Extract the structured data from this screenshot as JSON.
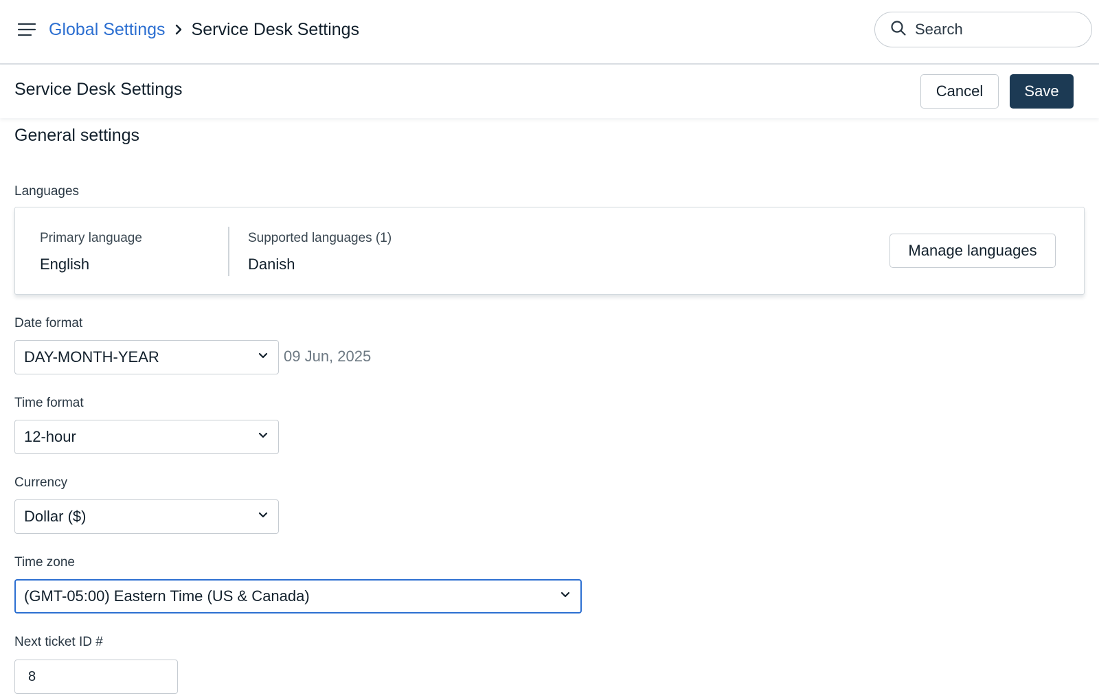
{
  "breadcrumb": {
    "parent": "Global Settings",
    "current": "Service Desk Settings"
  },
  "search": {
    "placeholder": "Search"
  },
  "header": {
    "title": "Service Desk Settings",
    "cancel_label": "Cancel",
    "save_label": "Save"
  },
  "general": {
    "title": "General settings",
    "languages": {
      "label": "Languages",
      "primary_label": "Primary language",
      "primary_value": "English",
      "supported_label": "Supported languages (1)",
      "supported_value": "Danish",
      "manage_label": "Manage languages"
    },
    "date_format": {
      "label": "Date format",
      "value": "DAY-MONTH-YEAR",
      "preview": "09 Jun, 2025"
    },
    "time_format": {
      "label": "Time format",
      "value": "12-hour"
    },
    "currency": {
      "label": "Currency",
      "value": "Dollar ($)"
    },
    "time_zone": {
      "label": "Time zone",
      "value": "(GMT-05:00) Eastern Time (US & Canada)"
    },
    "next_ticket": {
      "label": "Next ticket ID #",
      "value": "8"
    }
  },
  "colors": {
    "link": "#2c6fd1",
    "primary_button": "#1c3a54",
    "focus_border": "#2c6fd1"
  },
  "icons": [
    "hamburger-menu-icon",
    "chevron-right-icon",
    "search-icon",
    "chevron-down-icon"
  ]
}
